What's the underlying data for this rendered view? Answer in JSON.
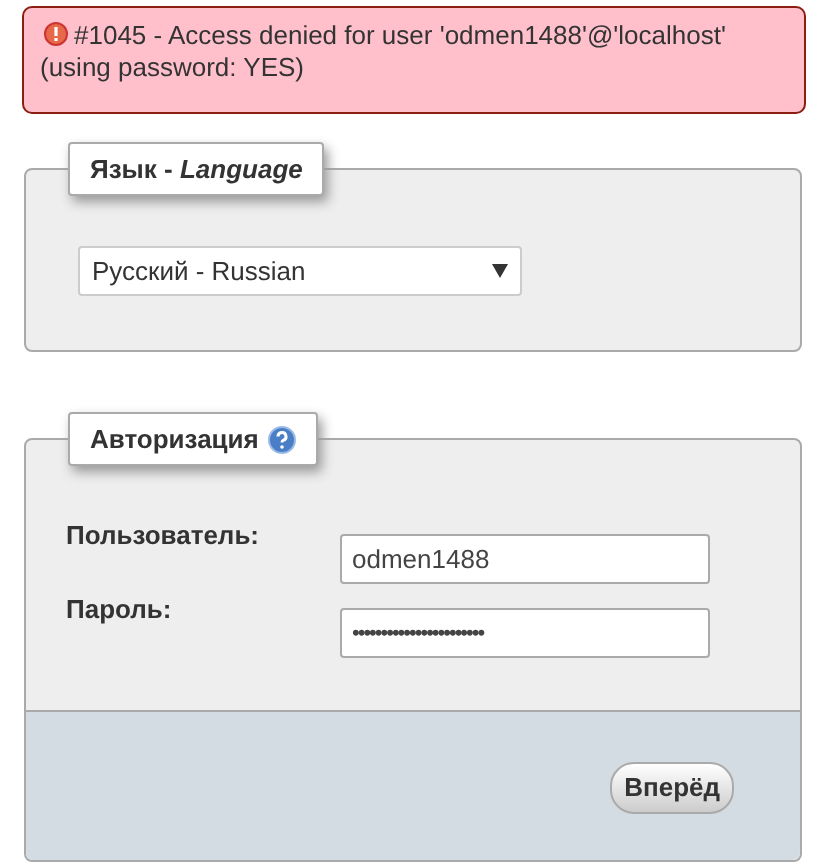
{
  "error": {
    "text": "#1045 - Access denied for user 'odmen1488'@'localhost' (using password: YES)"
  },
  "language": {
    "legend": "Язык - *Language*",
    "select": {
      "value": "Русский - Russian"
    }
  },
  "login": {
    "legend": "Авторизация",
    "fields": [
      {
        "label": "Пользователь:",
        "kind": "text",
        "value": "odmen1488"
      },
      {
        "label": "Пароль:",
        "kind": "password",
        "value": "•••••••••••••••••••••••"
      }
    ],
    "submit": "Вперёд"
  }
}
